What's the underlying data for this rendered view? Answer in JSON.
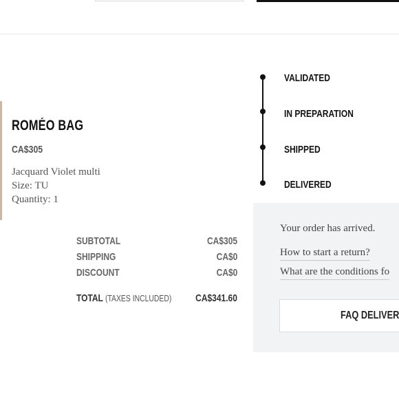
{
  "product": {
    "name": "ROMÉO BAG",
    "price": "CA$305",
    "description": "Jacquard Violet multi",
    "size": "Size: TU",
    "quantity": "Quantity: 1"
  },
  "totals": {
    "subtotal_label": "SUBTOTAL",
    "subtotal_value": "CA$305",
    "shipping_label": "SHIPPING",
    "shipping_value": "CA$0",
    "discount_label": "DISCOUNT",
    "discount_value": "CA$0",
    "total_label": "TOTAL",
    "total_note": "(TAXES INCLUDED)",
    "total_value": "CA$341.60"
  },
  "tracking": {
    "steps": [
      "VALIDATED",
      "IN PREPARATION",
      "SHIPPED",
      "DELIVERED"
    ]
  },
  "info_panel": {
    "message": "Your order has arrived.",
    "links": [
      "How to start a return?",
      "What are the conditions fo"
    ],
    "faq_button": "FAQ DELIVERY"
  },
  "colors": {
    "panel_bg": "#f2f3f5",
    "timeline": "#111111"
  }
}
